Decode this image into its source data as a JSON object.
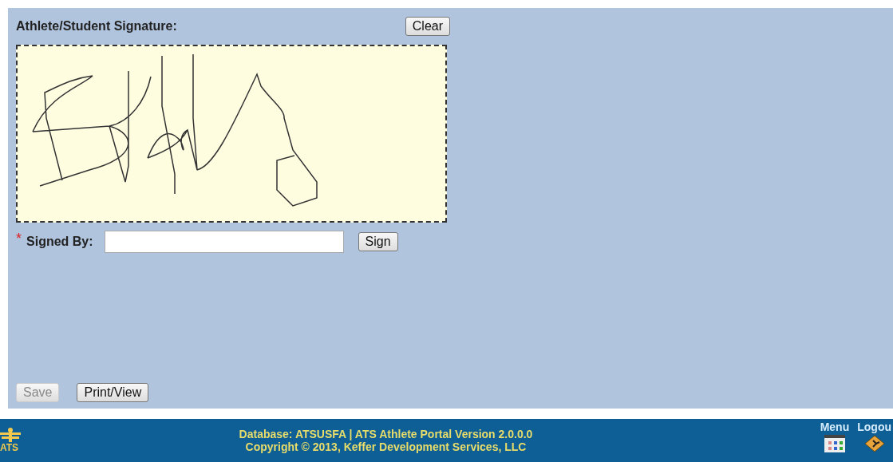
{
  "signature": {
    "label": "Athlete/Student Signature:",
    "clear_button": "Clear"
  },
  "signed_by": {
    "required_mark": "*",
    "label": "Signed By:",
    "sign_button": "Sign"
  },
  "actions": [
    {
      "label": "Save",
      "disabled": true
    },
    {
      "label": "Print/View",
      "disabled": false
    }
  ],
  "footer": {
    "logo": "ATS",
    "lines": [
      "Database: ATSUSFA | ATS Athlete Portal Version 2.0.0.0",
      "Copyright © 2013, Keffer Development Services, LLC"
    ],
    "links": [
      {
        "label": "Menu",
        "kind": "menu"
      },
      {
        "label": "Logou",
        "kind": "logout"
      }
    ]
  }
}
